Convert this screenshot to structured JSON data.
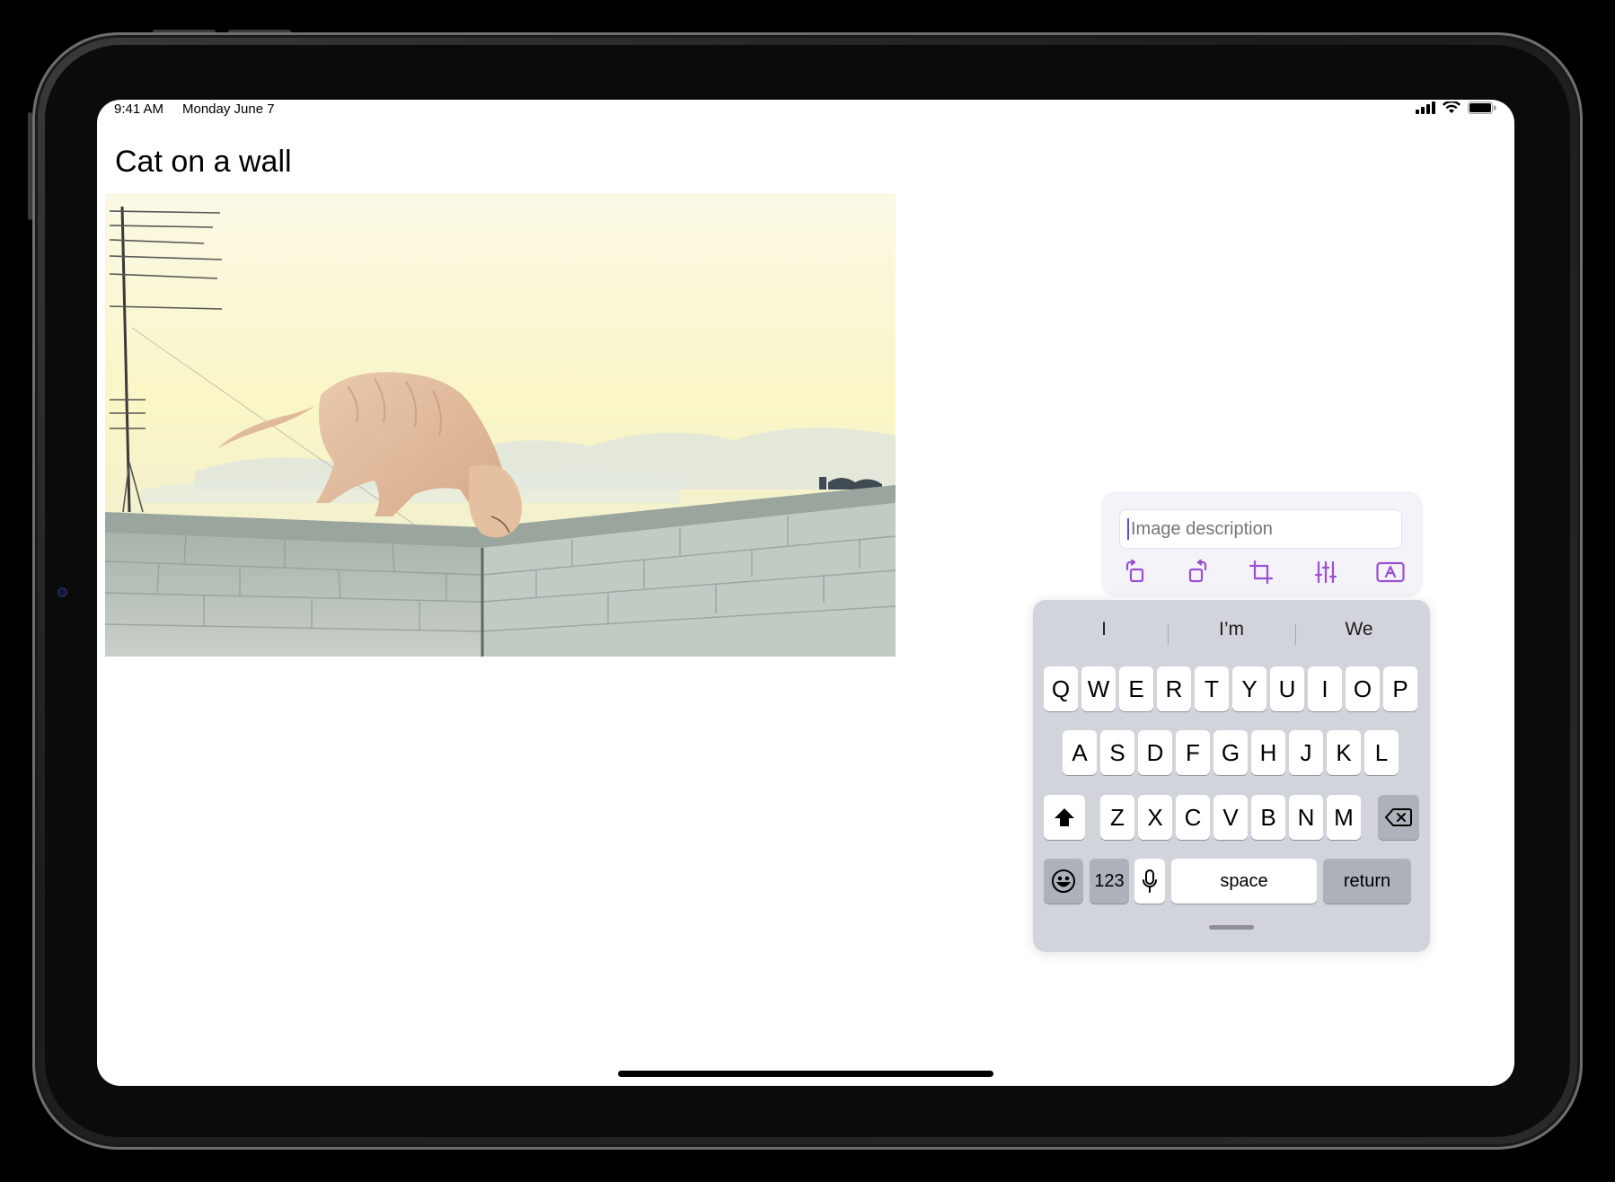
{
  "status_bar": {
    "time": "9:41 AM",
    "date": "Monday June 7",
    "icons": [
      "signal-icon",
      "wifi-icon",
      "battery-icon"
    ]
  },
  "page": {
    "title": "Cat on a wall"
  },
  "editor": {
    "description_placeholder": "Image description",
    "description_value": "",
    "tools": [
      "rotate-left-icon",
      "rotate-right-icon",
      "crop-icon",
      "adjust-sliders-icon",
      "text-recognition-icon"
    ],
    "accent_color": "#9b4fd3"
  },
  "keyboard": {
    "suggestions": [
      "I",
      "I’m",
      "We"
    ],
    "row1": [
      "Q",
      "W",
      "E",
      "R",
      "T",
      "Y",
      "U",
      "I",
      "O",
      "P"
    ],
    "row2": [
      "A",
      "S",
      "D",
      "F",
      "G",
      "H",
      "J",
      "K",
      "L"
    ],
    "row3": [
      "Z",
      "X",
      "C",
      "V",
      "B",
      "N",
      "M"
    ],
    "shift_icon": "shift-icon",
    "delete_icon": "delete-icon",
    "emoji_icon": "emoji-icon",
    "numbers_label": "123",
    "mic_icon": "microphone-icon",
    "space_label": "space",
    "return_label": "return"
  }
}
